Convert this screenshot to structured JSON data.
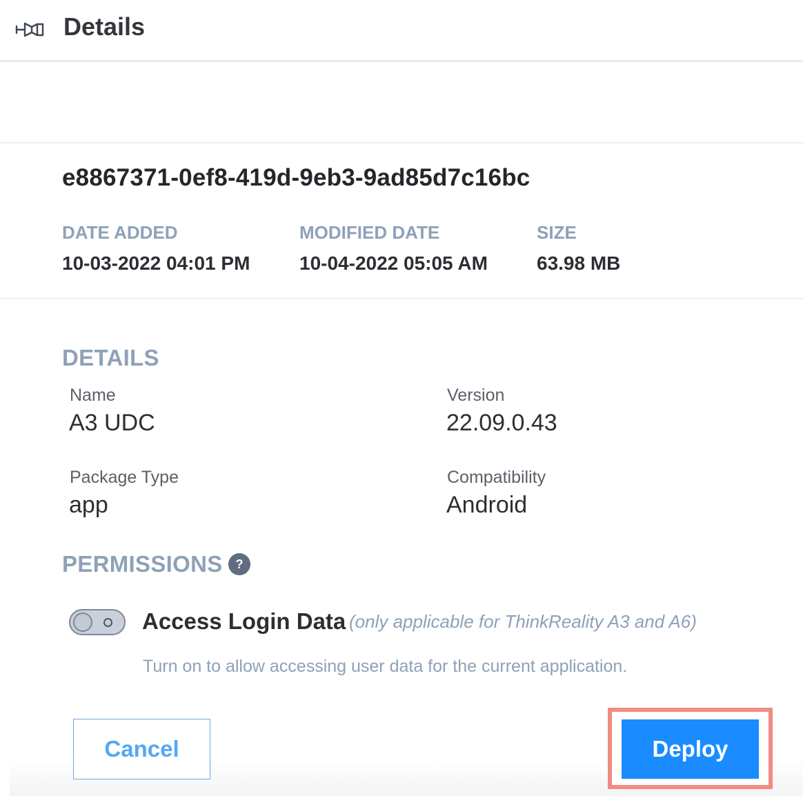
{
  "header": {
    "title": "Details",
    "icon": "package-deploy-icon"
  },
  "package": {
    "id": "e8867371-0ef8-419d-9eb3-9ad85d7c16bc",
    "date_added_label": "DATE ADDED",
    "date_added": "10-03-2022 04:01 PM",
    "modified_date_label": "MODIFIED DATE",
    "modified_date": "10-04-2022 05:05 AM",
    "size_label": "SIZE",
    "size": "63.98 MB"
  },
  "details": {
    "title": "DETAILS",
    "name_label": "Name",
    "name": "A3 UDC",
    "version_label": "Version",
    "version": "22.09.0.43",
    "package_type_label": "Package Type",
    "package_type": "app",
    "compatibility_label": "Compatibility",
    "compatibility": "Android"
  },
  "permissions": {
    "title": "PERMISSIONS",
    "help": "?",
    "access_login_label": "Access Login Data",
    "access_login_note": "(only applicable for ThinkReality A3 and A6)",
    "access_login_enabled": false,
    "access_login_desc": "Turn on to allow accessing user data for the current application."
  },
  "actions": {
    "cancel_label": "Cancel",
    "deploy_label": "Deploy"
  },
  "colors": {
    "accent": "#1a8cff",
    "muted": "#8ea1b7",
    "highlight": "#f28b82"
  }
}
